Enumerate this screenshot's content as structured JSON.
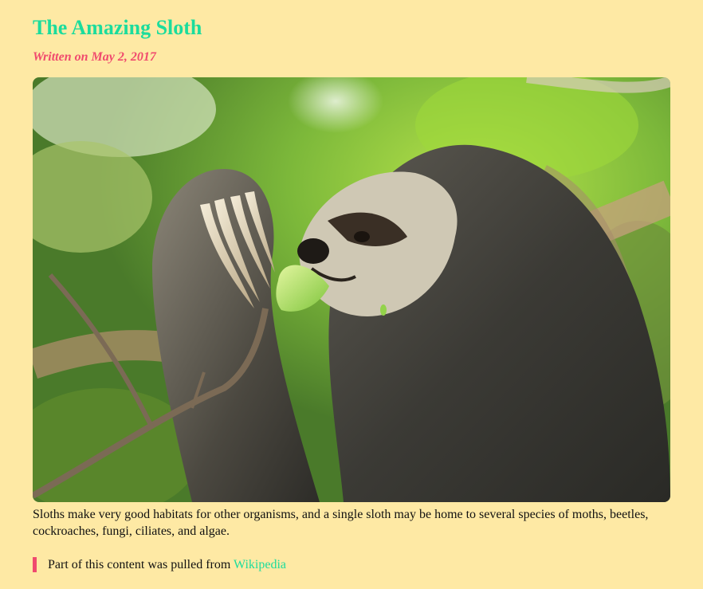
{
  "article": {
    "title": "The Amazing Sloth",
    "byline": "Written on May 2, 2017",
    "image_subject": "three-toed sloth eating a leaf",
    "paragraph": "Sloths make very good habitats for other organisms, and a single sloth may be home to several species of moths, beetles, cockroaches, fungi, ciliates, and algae.",
    "source_prefix": "Part of this content was pulled from",
    "source_link": "Wikipedia"
  },
  "colors": {
    "background": "#fee9a4",
    "title": "#1bdc9c",
    "byline": "#f04a6e",
    "link": "#1bdc9c",
    "quote_bar": "#f04a6e"
  }
}
